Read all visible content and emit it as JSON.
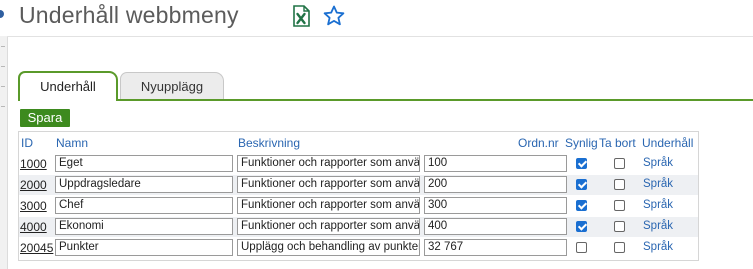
{
  "page": {
    "title": "Underhåll webbmeny"
  },
  "icons": {
    "excel": "excel-export-icon",
    "star": "favorite-star-icon"
  },
  "colors": {
    "accent": "#5a9a2a",
    "save": "#3d8a1e",
    "link": "#2a66b1",
    "checkbox": "#1a6fd1"
  },
  "tabs": [
    {
      "label": "Underhåll",
      "active": true
    },
    {
      "label": "Nyupplägg",
      "active": false
    }
  ],
  "toolbar": {
    "save_label": "Spara"
  },
  "table": {
    "headers": {
      "id": "ID",
      "name": "Namn",
      "description": "Beskrivning",
      "order": "Ordn.nr",
      "visible": "Synlig",
      "delete": "Ta bort",
      "maintain": "Underhåll"
    },
    "rows": [
      {
        "id": "1000",
        "name": "Eget",
        "description": "Funktioner och rapporter som anvä",
        "order": "100",
        "visible": true,
        "delete": false,
        "link": "Språk"
      },
      {
        "id": "2000",
        "name": "Uppdragsledare",
        "description": "Funktioner och rapporter som anvä",
        "order": "200",
        "visible": true,
        "delete": false,
        "link": "Språk"
      },
      {
        "id": "3000",
        "name": "Chef",
        "description": "Funktioner och rapporter som anvä",
        "order": "300",
        "visible": true,
        "delete": false,
        "link": "Språk"
      },
      {
        "id": "4000",
        "name": "Ekonomi",
        "description": "Funktioner och rapporter som anvä",
        "order": "400",
        "visible": true,
        "delete": false,
        "link": "Språk"
      },
      {
        "id": "20045",
        "name": "Punkter",
        "description": "Upplägg och behandling av punkter",
        "order": "32 767",
        "visible": false,
        "delete": false,
        "link": "Språk"
      }
    ]
  }
}
